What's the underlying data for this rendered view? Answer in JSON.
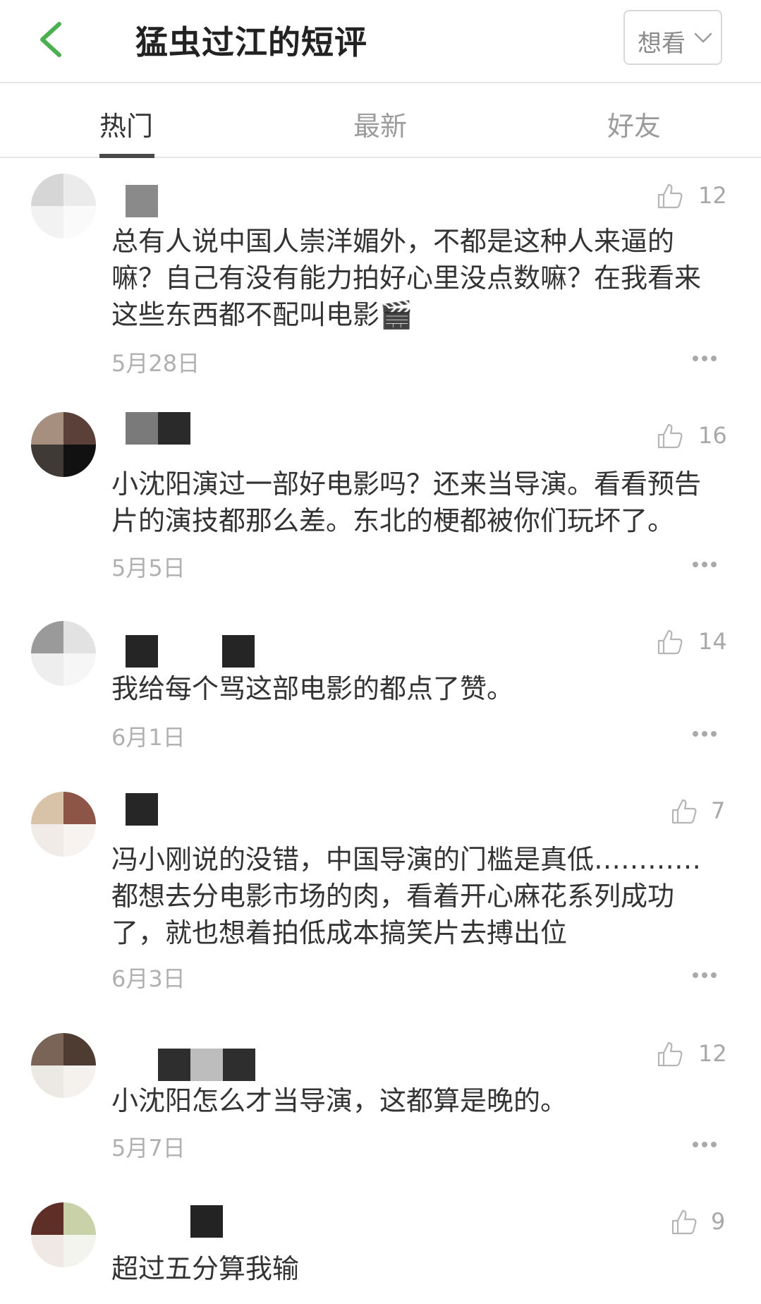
{
  "header": {
    "title": "猛虫过江的短评",
    "want_label": "想看",
    "accent_color": "#4caf50"
  },
  "tabs": [
    {
      "label": "热门",
      "active": true
    },
    {
      "label": "最新",
      "active": false
    },
    {
      "label": "好友",
      "active": false
    }
  ],
  "comments": [
    {
      "text": "总有人说中国人崇洋媚外，不都是这种人来逼的嘛？自己有没有能力拍好心里没点数嘛？在我看来这些东西都不配叫电影🎬",
      "date": "5月28日",
      "likes": "12"
    },
    {
      "text": "小沈阳演过一部好电影吗？还来当导演。看看预告片的演技都那么差。东北的梗都被你们玩坏了。",
      "date": "5月5日",
      "likes": "16"
    },
    {
      "text": "我给每个骂这部电影的都点了赞。",
      "date": "6月1日",
      "likes": "14"
    },
    {
      "text": "冯小刚说的没错，中国导演的门槛是真低…………都想去分电影市场的肉，看着开心麻花系列成功了，就也想着拍低成本搞笑片去搏出位",
      "date": "6月3日",
      "likes": "7"
    },
    {
      "text": "小沈阳怎么才当导演，这都算是晚的。",
      "date": "5月7日",
      "likes": "12"
    },
    {
      "text": "超过五分算我输",
      "date": "",
      "likes": "9"
    }
  ],
  "icons": {
    "back": "chevron-left-icon",
    "want_dropdown": "chevron-down-icon",
    "like": "thumbs-up-icon",
    "more": "more-dots-icon"
  }
}
